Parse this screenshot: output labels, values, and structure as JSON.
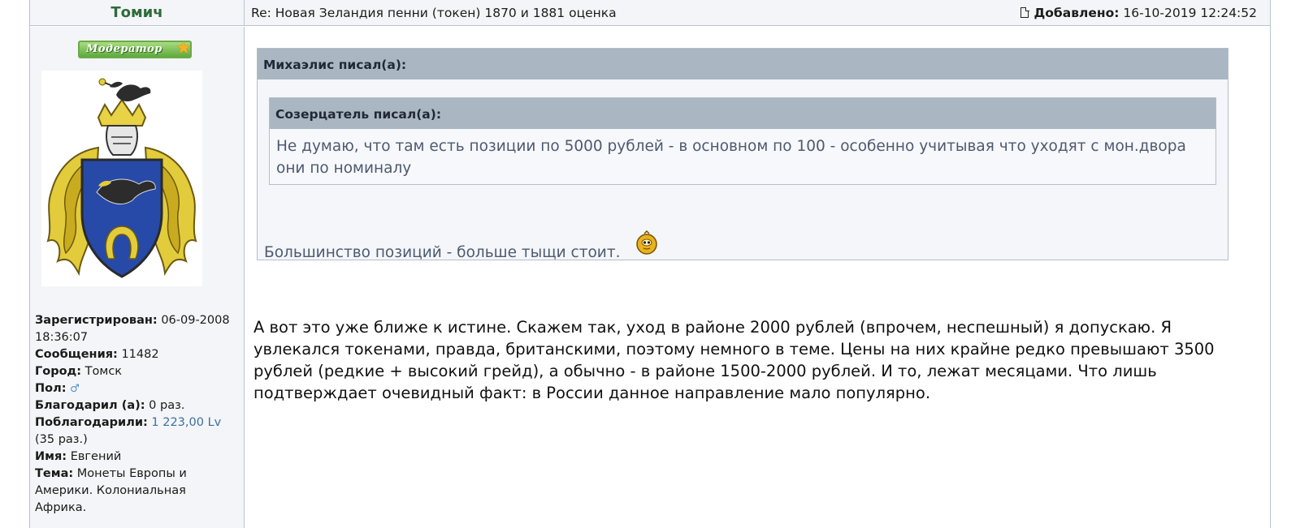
{
  "header": {
    "author": "Томич",
    "subject": "Re: Новая Зеландия пенни (токен) 1870 и 1881 оценка",
    "added_label": "Добавлено:",
    "added_value": "16-10-2019 12:24:52"
  },
  "author_panel": {
    "rank_badge": "Модератор",
    "avatar_icon": "coat-of-arms-icon",
    "fields": [
      {
        "label": "Зарегистрирован:",
        "value": "06-09-2008 18:36:07"
      },
      {
        "label": "Сообщения:",
        "value": "11482"
      },
      {
        "label": "Город:",
        "value": "Томск"
      },
      {
        "label": "Пол:",
        "value": "♂"
      },
      {
        "label": "Благодарил (а):",
        "value": "0 раз."
      },
      {
        "label": "Поблагодарили:",
        "value": "1 223,00 Lv",
        "extra": "(35 раз.)"
      },
      {
        "label": "Имя:",
        "value": "Евгений"
      },
      {
        "label": "Тема:",
        "value": "Монеты Европы и Америки. Колониальная Африка."
      }
    ]
  },
  "quotes": {
    "outer_header": "Михаэлис писал(а):",
    "inner_header": "Созерцатель писал(а):",
    "inner_text": "Не думаю, что там есть позиции по 5000 рублей - в основном по 100 - особенно учитывая что уходят с мон.двора они по номиналу",
    "outer_text": "Большинство позиций - больше тыщи стоит."
  },
  "body_text": "А вот это уже ближе к истине. Скажем так, уход в районе 2000 рублей (впрочем, неспешный) я допускаю. Я увлекался токенами, правда, британскими, поэтому немного в теме. Цены на них крайне редко превышают 3500 рублей (редкие + высокий грейд), а обычно - в районе 1500-2000 рублей. И то, лежат месяцами. Что лишь подтверждает очевидный факт: в России данное направление мало популярно.",
  "colors": {
    "author_name": "#2f6b3a",
    "quote_header_bg": "#aab6c2",
    "quote_text": "#4d5a70",
    "link": "#3d6f9e",
    "panel_bg": "#f3f5f8"
  }
}
